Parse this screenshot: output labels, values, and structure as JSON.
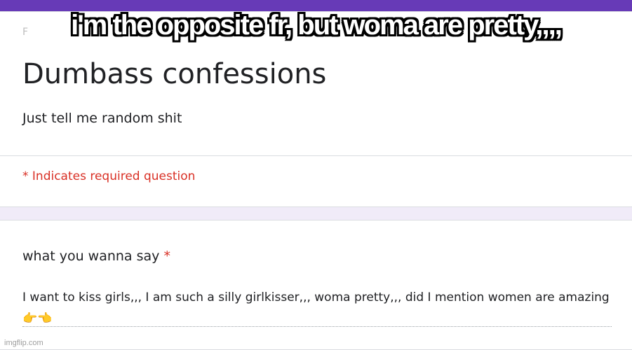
{
  "header": {
    "faint_label": "F",
    "title": "Dumbass confessions",
    "description": "Just tell me random shit",
    "required_note": "* Indicates required question"
  },
  "question": {
    "label": "what you wanna say",
    "required_marker": "*",
    "answer": "I want to kiss girls,,, I am such a silly girlkisser,,, woma pretty,,, did I mention women are amazing 👉👈"
  },
  "meme": {
    "caption": "i'm the opposite fr, but woma are pretty,,,,"
  },
  "watermark": {
    "text": "imgflip.com"
  },
  "colors": {
    "accent": "#673ab7",
    "background": "#f0ebf8",
    "required": "#d93025"
  }
}
